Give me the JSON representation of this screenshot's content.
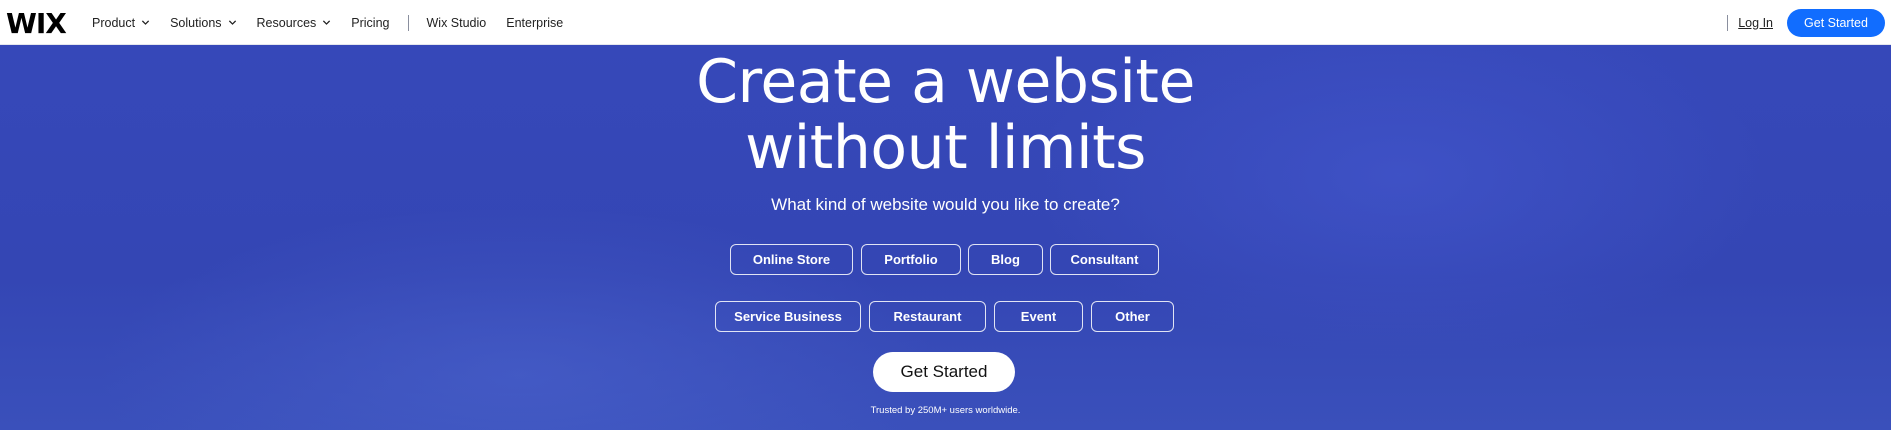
{
  "nav": {
    "logo": "WIX",
    "links": [
      {
        "label": "Product"
      },
      {
        "label": "Solutions"
      },
      {
        "label": "Resources"
      },
      {
        "label": "Pricing"
      }
    ],
    "secondary_links": [
      {
        "label": "Wix Studio"
      },
      {
        "label": "Enterprise"
      }
    ],
    "login_label": "Log In",
    "cta_label": "Get Started"
  },
  "hero": {
    "headline_line1": "Create a website",
    "headline_line2": "without limits",
    "subheading": "What kind of website would you like to create?",
    "categories": [
      "Online Store",
      "Portfolio",
      "Blog",
      "Consultant",
      "Service Business",
      "Restaurant",
      "Event",
      "Other"
    ],
    "cta_label": "Get Started",
    "trust_text": "Trusted by 250M+ users worldwide."
  },
  "colors": {
    "brand_blue": "#116dff",
    "hero_background": "#3446b8",
    "nav_background": "#ffffff"
  },
  "icons": [
    "chevron-down-icon"
  ]
}
